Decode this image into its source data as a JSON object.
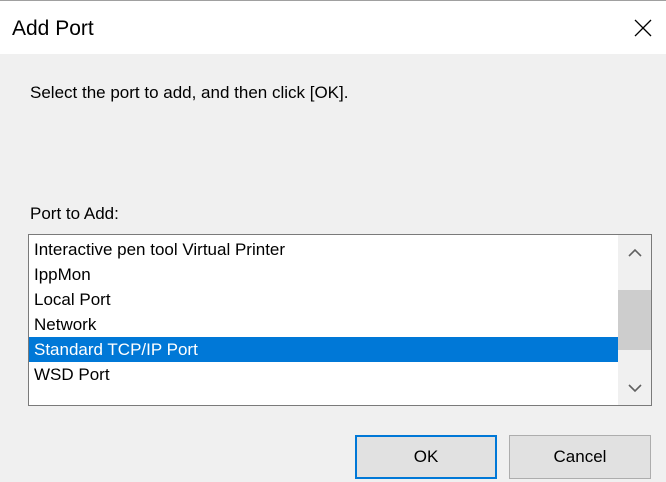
{
  "window": {
    "title": "Add Port",
    "close_icon": "close-icon"
  },
  "instruction": "Select the port to add, and then click [OK].",
  "port_list": {
    "label": "Port to Add:",
    "items": [
      {
        "label": "Interactive pen tool Virtual Printer",
        "selected": false
      },
      {
        "label": "IppMon",
        "selected": false
      },
      {
        "label": "Local Port",
        "selected": false
      },
      {
        "label": "Network",
        "selected": false
      },
      {
        "label": "Standard TCP/IP Port",
        "selected": true
      },
      {
        "label": "WSD Port",
        "selected": false
      }
    ],
    "scroll_position": 0.5
  },
  "buttons": {
    "ok_label": "OK",
    "cancel_label": "Cancel"
  },
  "colors": {
    "selection": "#0078d7",
    "dialog_bg": "#f0f0f0",
    "default_button_border": "#0078d7"
  }
}
